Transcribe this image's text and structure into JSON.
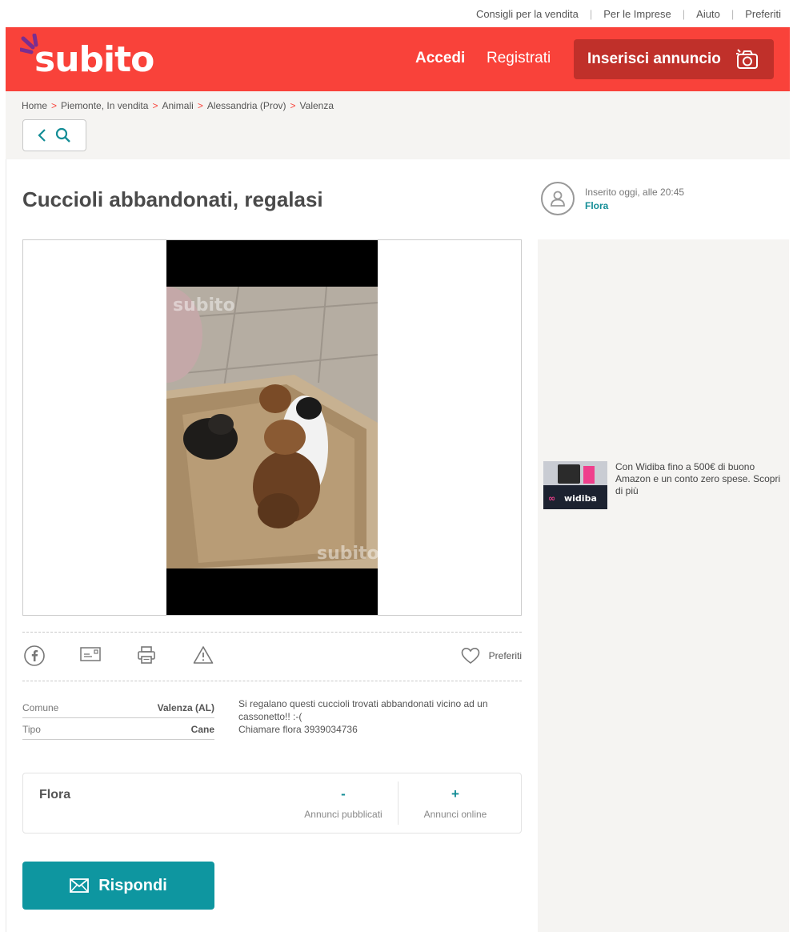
{
  "topbar": {
    "links": [
      "Consigli per la vendita",
      "Per le Imprese",
      "Aiuto",
      "Preferiti"
    ]
  },
  "header": {
    "logo_text": "subito",
    "login": "Accedi",
    "register": "Registrati",
    "insert_ad": "Inserisci annuncio",
    "brand_color": "#f9423a"
  },
  "breadcrumb": [
    "Home",
    "Piemonte, In vendita",
    "Animali",
    "Alessandria (Prov)",
    "Valenza"
  ],
  "ad_listing": {
    "title": "Cuccioli abbandonati, regalasi",
    "posted": "Inserito oggi, alle 20:45",
    "poster_name": "Flora",
    "favorites_label": "Preferiti",
    "details": [
      {
        "label": "Comune",
        "value": "Valenza (AL)"
      },
      {
        "label": "Tipo",
        "value": "Cane"
      }
    ],
    "description_line1": "Si regalano questi cuccioli trovati abbandonati vicino ad un cassonetto!! :-(",
    "description_line2": "Chiamare flora 3939034736",
    "photo_watermark": "subito"
  },
  "user_card": {
    "name": "Flora",
    "published_value": "-",
    "published_label": "Annunci pubblicati",
    "online_value": "+",
    "online_label": "Annunci online"
  },
  "reply_label": "Rispondi",
  "side_ad": {
    "text": "Con Widiba fino a 500€ di buono Amazon e un conto zero spese. Scopri di più",
    "brand": "widiba"
  },
  "colors": {
    "accent_teal": "#0e96a0",
    "header_red": "#f9423a",
    "insert_button": "#c0302a"
  }
}
